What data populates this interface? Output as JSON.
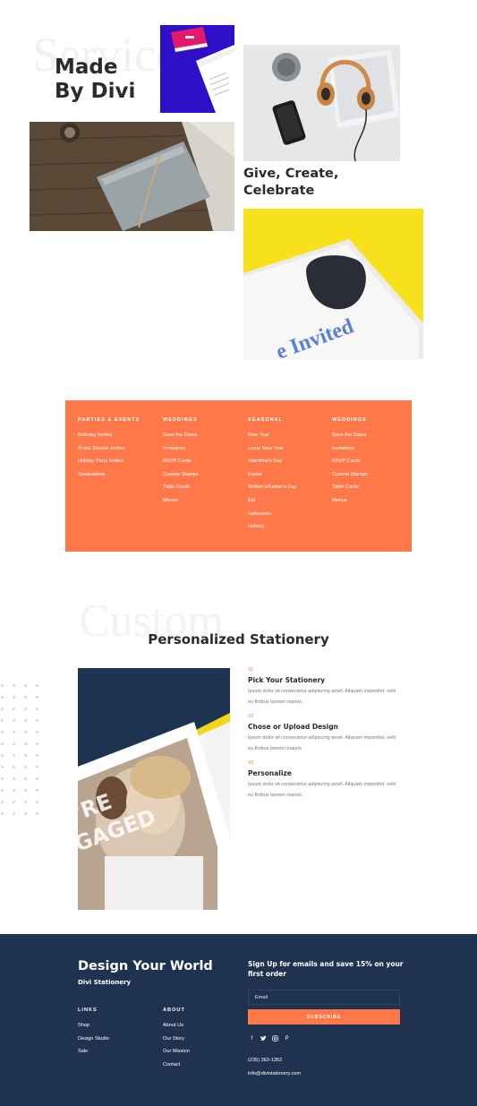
{
  "hero": {
    "ghost_word": "Services",
    "title": "Made By Divi",
    "subtitle": "Give, Create, Celebrate",
    "invite_text": "e Invited"
  },
  "menu": {
    "columns": [
      {
        "heading": "Parties & Events",
        "items": [
          "Birthday Invites",
          "Bridal Shower Invites",
          "Holiday Party Invites",
          "Graduations"
        ]
      },
      {
        "heading": "Weddings",
        "items": [
          "Save the Dates",
          "Invitations",
          "RSVP Cards",
          "Custom Stamps",
          "Table Cards",
          "Menus"
        ]
      },
      {
        "heading": "Seasonal",
        "items": [
          "New Year",
          "Lunar New Year",
          "Valentine's Day",
          "Easter",
          "Mother's/Father's Day",
          "Eid",
          "Halloween",
          "Holiday"
        ]
      },
      {
        "heading": "Weddings",
        "items": [
          "Save the Dates",
          "Invitations",
          "RSVP Cards",
          "Custom Stamps",
          "Table Cards",
          "Menus"
        ]
      }
    ]
  },
  "personalized": {
    "ghost_word": "Custom",
    "title": "Personalized Stationery",
    "photo_text": [
      "'RE",
      "GAGED"
    ],
    "steps": [
      {
        "num": "01",
        "title": "Pick Your Stationery",
        "text": "Ipsum dolor sit consectetur adipiscing amet. Aliquam imperdiet, velit eu finibus laoreet mauris."
      },
      {
        "num": "02",
        "title": "Chose or Upload Design",
        "text": "Ipsum dolor sit consectetur adipiscing amet. Aliquam imperdiet, velit eu finibus laoreet mauris."
      },
      {
        "num": "03",
        "title": "Personalize",
        "text": "Ipsum dolor sit consectetur adipiscing amet. Aliquam imperdiet, velit eu finibus laoreet mauris."
      }
    ]
  },
  "footer": {
    "title": "Design Your World",
    "brand": "Divi Stationery",
    "links_heading": "Links",
    "links": [
      "Shop",
      "Design Studio",
      "Sale"
    ],
    "about_heading": "About",
    "about_links": [
      "About Us",
      "Our Story",
      "Our Mission",
      "Contact"
    ],
    "signup_text": "Sign Up for emails and save 15% on your first order",
    "email_placeholder": "Email",
    "subscribe_label": "Subscribe",
    "social": [
      {
        "icon": "facebook-icon",
        "glyph": "f"
      },
      {
        "icon": "twitter-icon",
        "glyph": "🐦"
      },
      {
        "icon": "instagram-icon",
        "glyph": "◎"
      },
      {
        "icon": "pinterest-icon",
        "glyph": "P"
      }
    ],
    "phone": "(235) 362-1352",
    "email": "info@divistationery.com"
  },
  "colors": {
    "accent_orange": "#ff7849",
    "navy": "#1f3350",
    "hero_card_blue": "#2f10c9",
    "invite_yellow": "#f7e11c"
  }
}
